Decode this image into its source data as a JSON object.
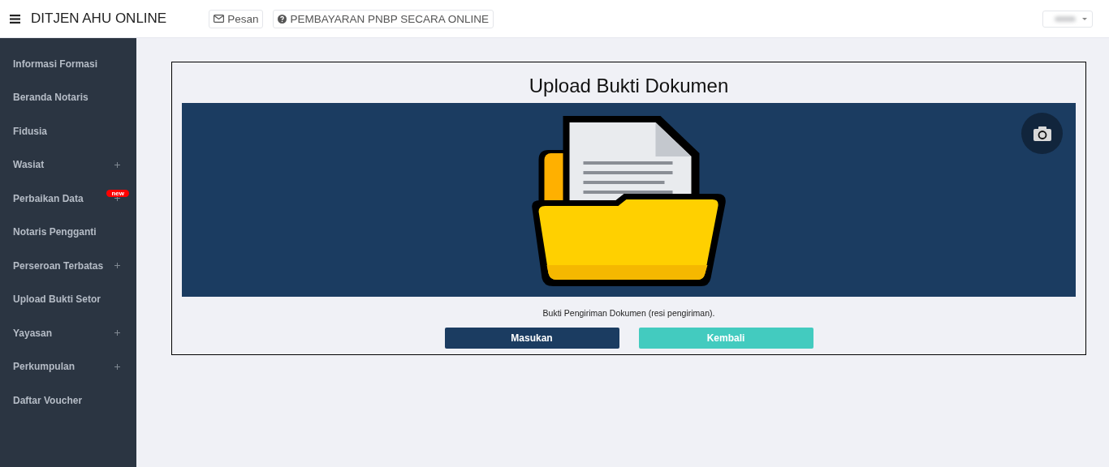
{
  "header": {
    "title": "DITJEN AHU ONLINE",
    "links": [
      {
        "kind": "mail",
        "label": "Pesan"
      },
      {
        "kind": "help",
        "label": "PEMBAYARAN PNBP SECARA ONLINE"
      }
    ]
  },
  "sidebar": {
    "items": [
      {
        "label": "Informasi Formasi",
        "expandable": false
      },
      {
        "label": "Beranda Notaris",
        "expandable": false
      },
      {
        "label": "Fidusia",
        "expandable": false
      },
      {
        "label": "Wasiat",
        "expandable": true
      },
      {
        "label": "Perbaikan Data",
        "expandable": true,
        "badge": "new"
      },
      {
        "label": "Notaris Pengganti",
        "expandable": false
      },
      {
        "label": "Perseroan Terbatas",
        "expandable": true
      },
      {
        "label": "Upload Bukti Setor",
        "expandable": false
      },
      {
        "label": "Yayasan",
        "expandable": true
      },
      {
        "label": "Perkumpulan",
        "expandable": true
      },
      {
        "label": "Daftar Voucher",
        "expandable": false
      }
    ]
  },
  "panel": {
    "title": "Upload Bukti Dokumen",
    "caption": "Bukti Pengiriman Dokumen (resi pengiriman).",
    "buttons": [
      {
        "kind": "primary",
        "label": "Masukan"
      },
      {
        "kind": "secondary",
        "label": "Kembali"
      }
    ]
  }
}
